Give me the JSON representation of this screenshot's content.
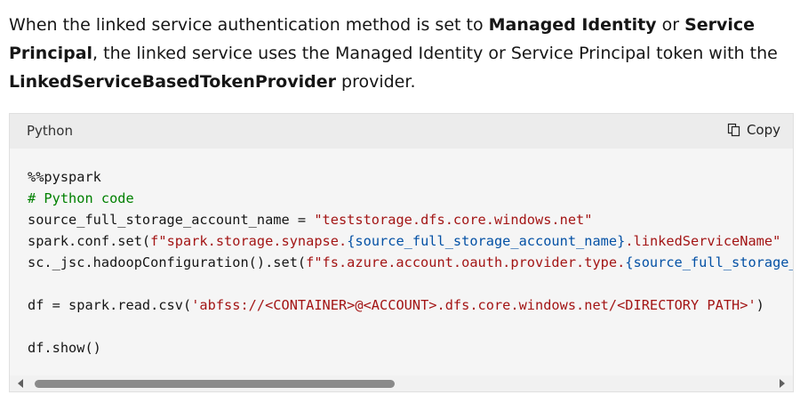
{
  "intro": {
    "part1": "When the linked service authentication method is set to ",
    "bold1": "Managed Identity",
    "part2": " or ",
    "bold2": "Service Principal",
    "part3": ", the linked service uses the Managed Identity or Service Principal token with the ",
    "bold3": "LinkedServiceBasedTokenProvider",
    "part4": " provider."
  },
  "code": {
    "language": "Python",
    "copy_label": "Copy",
    "lines": {
      "l1": "%%pyspark",
      "l2": "# Python code",
      "l3a": "source_full_storage_account_name = ",
      "l3b": "\"teststorage.dfs.core.windows.net\"",
      "l4a": "spark.conf.set(",
      "l4b": "f\"spark.storage.synapse.",
      "l4c": "{source_full_storage_account_name}",
      "l4d": ".linkedServiceName\"",
      "l5a": "sc._jsc.hadoopConfiguration().set(",
      "l5b": "f\"fs.azure.account.oauth.provider.type.",
      "l5c": "{source_full_storage_account_name}",
      "l7a": "df = spark.read.csv(",
      "l7b": "'abfss://<CONTAINER>@<ACCOUNT>.dfs.core.windows.net/<DIRECTORY PATH>'",
      "l7c": ")",
      "l9": "df.show()"
    }
  },
  "colors": {
    "comment": "#008000",
    "string": "#a31515",
    "interpolation": "#0451a5"
  },
  "icons": {
    "copy": "copy-icon",
    "scroll_left": "scroll-left-arrow-icon",
    "scroll_right": "scroll-right-arrow-icon"
  },
  "scroll": {
    "horizontal_position": 0,
    "visible_fraction": 0.47
  }
}
